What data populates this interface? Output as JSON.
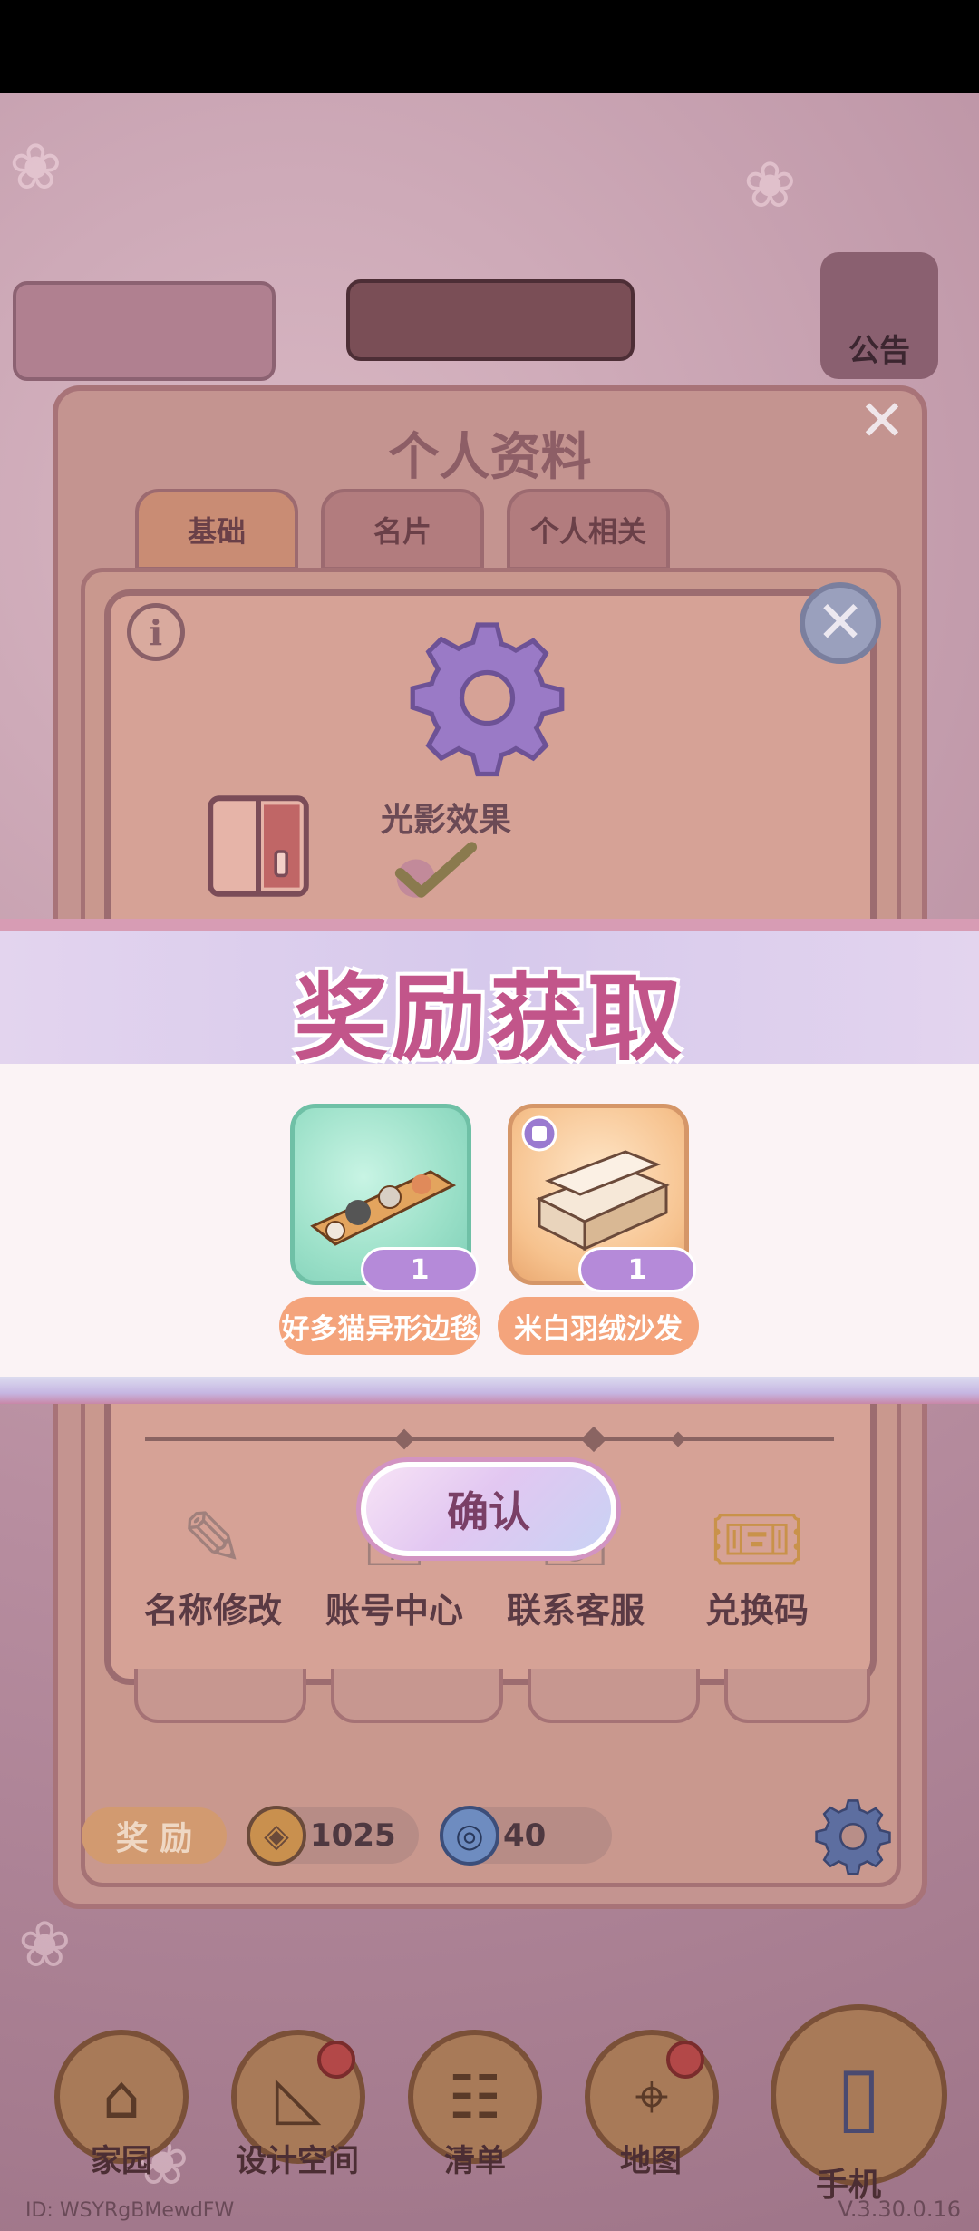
{
  "notice": {
    "label": "公告"
  },
  "profile": {
    "title": "个人资料",
    "tabs": [
      "基础",
      "名片",
      "个人相关"
    ]
  },
  "settings": {
    "info_glyph": "i",
    "light_shadow_label": "光影效果",
    "functions": [
      {
        "label": "名称修改",
        "icon": "pencil-icon"
      },
      {
        "label": "账号中心",
        "icon": "account-icon"
      },
      {
        "label": "联系客服",
        "icon": "headset-icon"
      },
      {
        "label": "兑换码",
        "icon": "ticket-icon"
      }
    ]
  },
  "footer": {
    "reward_label": "奖 励",
    "coins": "1025",
    "gems": "40"
  },
  "reward_popup": {
    "title": "奖励获取",
    "items": [
      {
        "name": "好多猫异形边毯",
        "quantity": "1"
      },
      {
        "name": "米白羽绒沙发",
        "quantity": "1"
      }
    ],
    "confirm_label": "确认"
  },
  "nav": {
    "items": [
      "家园",
      "设计空间",
      "清单",
      "地图"
    ],
    "phone_label": "手机"
  },
  "meta_text": {
    "id": "ID: WSYRgBMewdFW",
    "version": "V.3.30.0.16"
  },
  "colors": {
    "reward_title": "#c2558a",
    "name_pill": "#f4a47c",
    "qty_badge": "#b58ad9"
  }
}
